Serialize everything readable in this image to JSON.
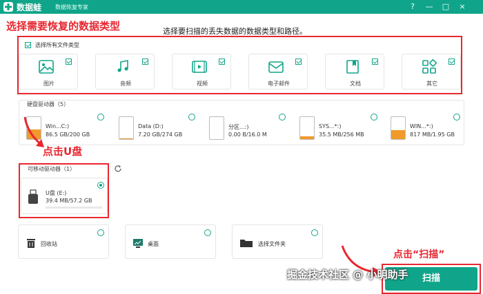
{
  "app": {
    "name": "数据蛙",
    "subtitle": "数据恢复专家",
    "brand_color": "#10a58a",
    "controls": [
      "?",
      "—",
      "□",
      "×"
    ]
  },
  "annotations": {
    "select_types": "选择需要恢复的数据类型",
    "click_usb": "点击U盘",
    "click_scan": "点击“扫描”",
    "color": "#e8262f"
  },
  "instruction": "选择要扫描的丢失数据的数据类型和路径。",
  "file_types": {
    "select_all_label": "选择所有文件类型",
    "select_all_checked": true,
    "items": [
      {
        "label": "图片",
        "icon": "image-icon",
        "checked": true
      },
      {
        "label": "音频",
        "icon": "music-icon",
        "checked": true
      },
      {
        "label": "视频",
        "icon": "video-icon",
        "checked": true
      },
      {
        "label": "电子邮件",
        "icon": "email-icon",
        "checked": true
      },
      {
        "label": "文档",
        "icon": "document-icon",
        "checked": true
      },
      {
        "label": "其它",
        "icon": "other-icon",
        "checked": true
      }
    ]
  },
  "hard_drives": {
    "title": "硬盘驱动器（5）",
    "items": [
      {
        "name": "Win...C:)",
        "size": "86.5 GB/200 GB",
        "used_fraction": 0.43,
        "selected": false
      },
      {
        "name": "Data (D:)",
        "size": "7.20 GB/274 GB",
        "used_fraction": 0.03,
        "selected": false
      },
      {
        "name": "分区...:)",
        "size": "0.00  B/16.0 M",
        "used_fraction": 0.0,
        "selected": false
      },
      {
        "name": "SYS...*:)",
        "size": "35.5 MB/256 MB",
        "used_fraction": 0.14,
        "selected": false
      },
      {
        "name": "WIN...*:)",
        "size": "817 MB/1.95 GB",
        "used_fraction": 0.42,
        "selected": false
      }
    ]
  },
  "removable": {
    "title": "可移动驱动器（1）",
    "refresh_icon": "refresh-icon",
    "items": [
      {
        "name": "U盘 (E:)",
        "size": "39.4 MB/57.2 GB",
        "used_fraction": 0.01,
        "selected": true
      }
    ]
  },
  "locations": [
    {
      "label": "回收站",
      "icon": "recycle-bin-icon"
    },
    {
      "label": "桌面",
      "icon": "desktop-icon"
    },
    {
      "label": "选择文件夹",
      "icon": "folder-icon"
    }
  ],
  "scan_button": "扫描",
  "watermark": "掘金技术社区 @ 小明助手"
}
